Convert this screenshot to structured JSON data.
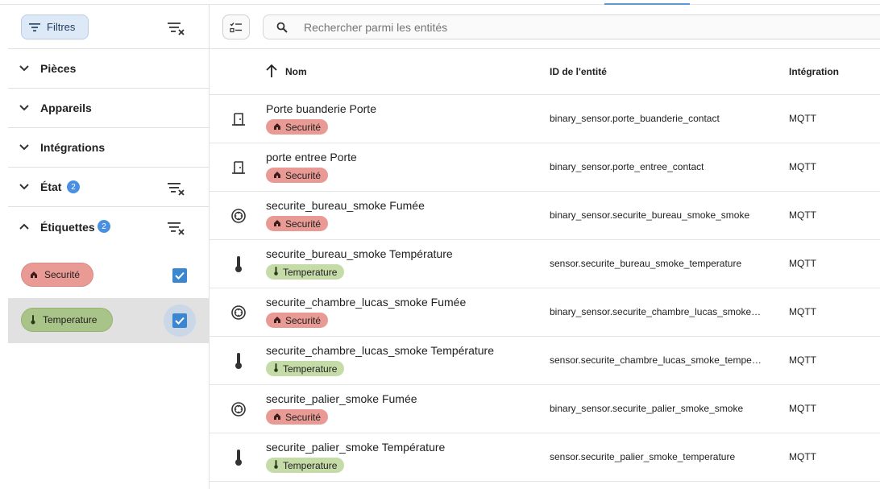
{
  "sidebar": {
    "filter_button": "Filtres",
    "sections": [
      {
        "label": "Pièces",
        "expanded": false,
        "badge": null
      },
      {
        "label": "Appareils",
        "expanded": false,
        "badge": null
      },
      {
        "label": "Intégrations",
        "expanded": false,
        "badge": null
      },
      {
        "label": "État",
        "expanded": false,
        "badge": "2"
      },
      {
        "label": "Étiquettes",
        "expanded": true,
        "badge": "2"
      }
    ],
    "labels": [
      {
        "name": "Securité",
        "icon": "home-shield-icon",
        "color": "#e99a95",
        "checked": true
      },
      {
        "name": "Temperature",
        "icon": "thermometer-icon",
        "color": "#a9c488",
        "checked": true
      }
    ]
  },
  "search": {
    "placeholder": "Rechercher parmi les entités"
  },
  "table": {
    "columns": {
      "name": "Nom",
      "entity_id": "ID de l'entité",
      "integration": "Intégration"
    },
    "rows": [
      {
        "icon": "door-icon",
        "name": "Porte buanderie Porte",
        "label": "Securité",
        "entity_id": "binary_sensor.porte_buanderie_contact",
        "integration": "MQTT"
      },
      {
        "icon": "door-icon",
        "name": "porte entree Porte",
        "label": "Securité",
        "entity_id": "binary_sensor.porte_entree_contact",
        "integration": "MQTT"
      },
      {
        "icon": "smoke-detector-icon",
        "name": "securite_bureau_smoke Fumée",
        "label": "Securité",
        "entity_id": "binary_sensor.securite_bureau_smoke_smoke",
        "integration": "MQTT"
      },
      {
        "icon": "thermometer-icon",
        "name": "securite_bureau_smoke Température",
        "label": "Temperature",
        "entity_id": "sensor.securite_bureau_smoke_temperature",
        "integration": "MQTT"
      },
      {
        "icon": "smoke-detector-icon",
        "name": "securite_chambre_lucas_smoke Fumée",
        "label": "Securité",
        "entity_id": "binary_sensor.securite_chambre_lucas_smoke_smoke",
        "integration": "MQTT"
      },
      {
        "icon": "thermometer-icon",
        "name": "securite_chambre_lucas_smoke Température",
        "label": "Temperature",
        "entity_id": "sensor.securite_chambre_lucas_smoke_temperature",
        "integration": "MQTT"
      },
      {
        "icon": "smoke-detector-icon",
        "name": "securite_palier_smoke Fumée",
        "label": "Securité",
        "entity_id": "binary_sensor.securite_palier_smoke_smoke",
        "integration": "MQTT"
      },
      {
        "icon": "thermometer-icon",
        "name": "securite_palier_smoke Température",
        "label": "Temperature",
        "entity_id": "sensor.securite_palier_smoke_temperature",
        "integration": "MQTT"
      }
    ]
  }
}
